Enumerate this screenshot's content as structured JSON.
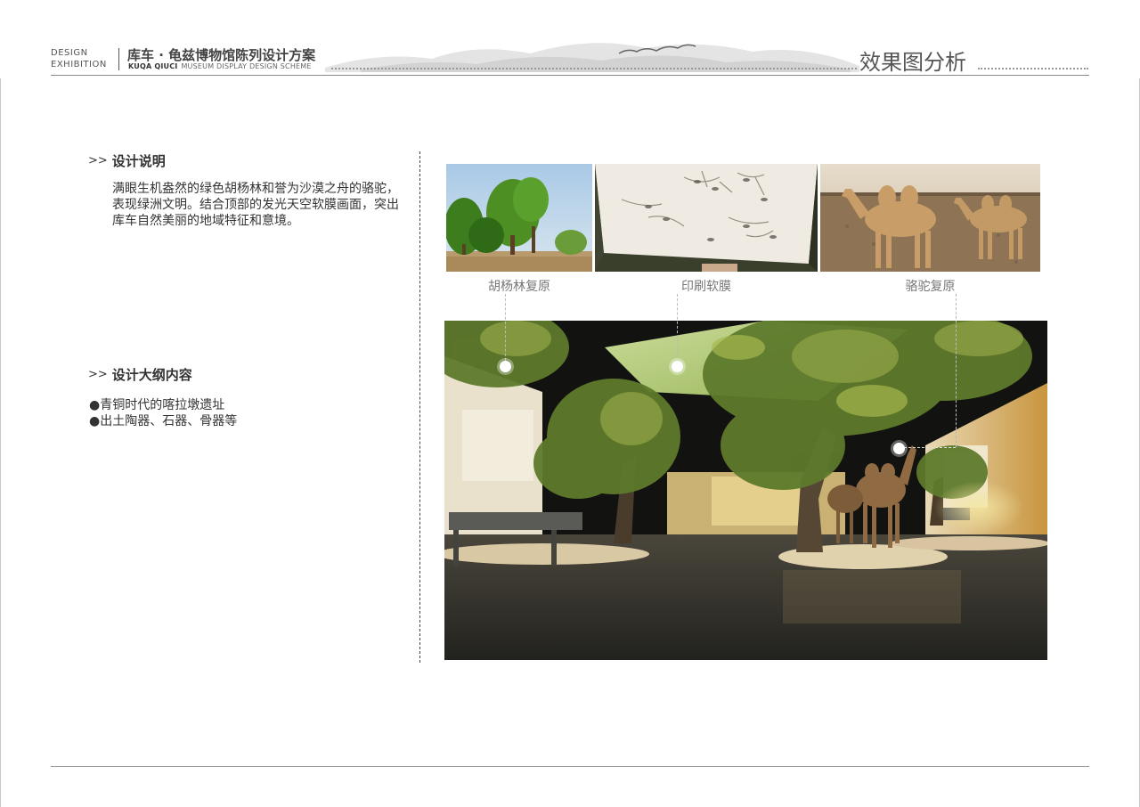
{
  "header": {
    "en_line1": "DESIGN",
    "en_line2": "EXHIBITION",
    "title": "库车 · 龟兹博物馆陈列设计方案",
    "subtitle_bold": "KUQA QIUCI",
    "subtitle": "MUSEUM DISPLAY DESIGN SCHEME",
    "page_heading": "效果图分析"
  },
  "section1": {
    "mark": ">>",
    "heading": "设计说明",
    "body": "满眼生机盎然的绿色胡杨林和誉为沙漠之舟的骆驼，表现绿洲文明。结合顶部的发光天空软膜画面，突出库车自然美丽的地域特征和意境。"
  },
  "section2": {
    "mark": ">>",
    "heading": "设计大纲内容",
    "items": [
      "●青铜时代的喀拉墩遗址",
      "●出土陶器、石器、骨器等"
    ]
  },
  "photos": {
    "captions": [
      "胡杨林复原",
      "印刷软膜",
      "骆驼复原"
    ]
  }
}
